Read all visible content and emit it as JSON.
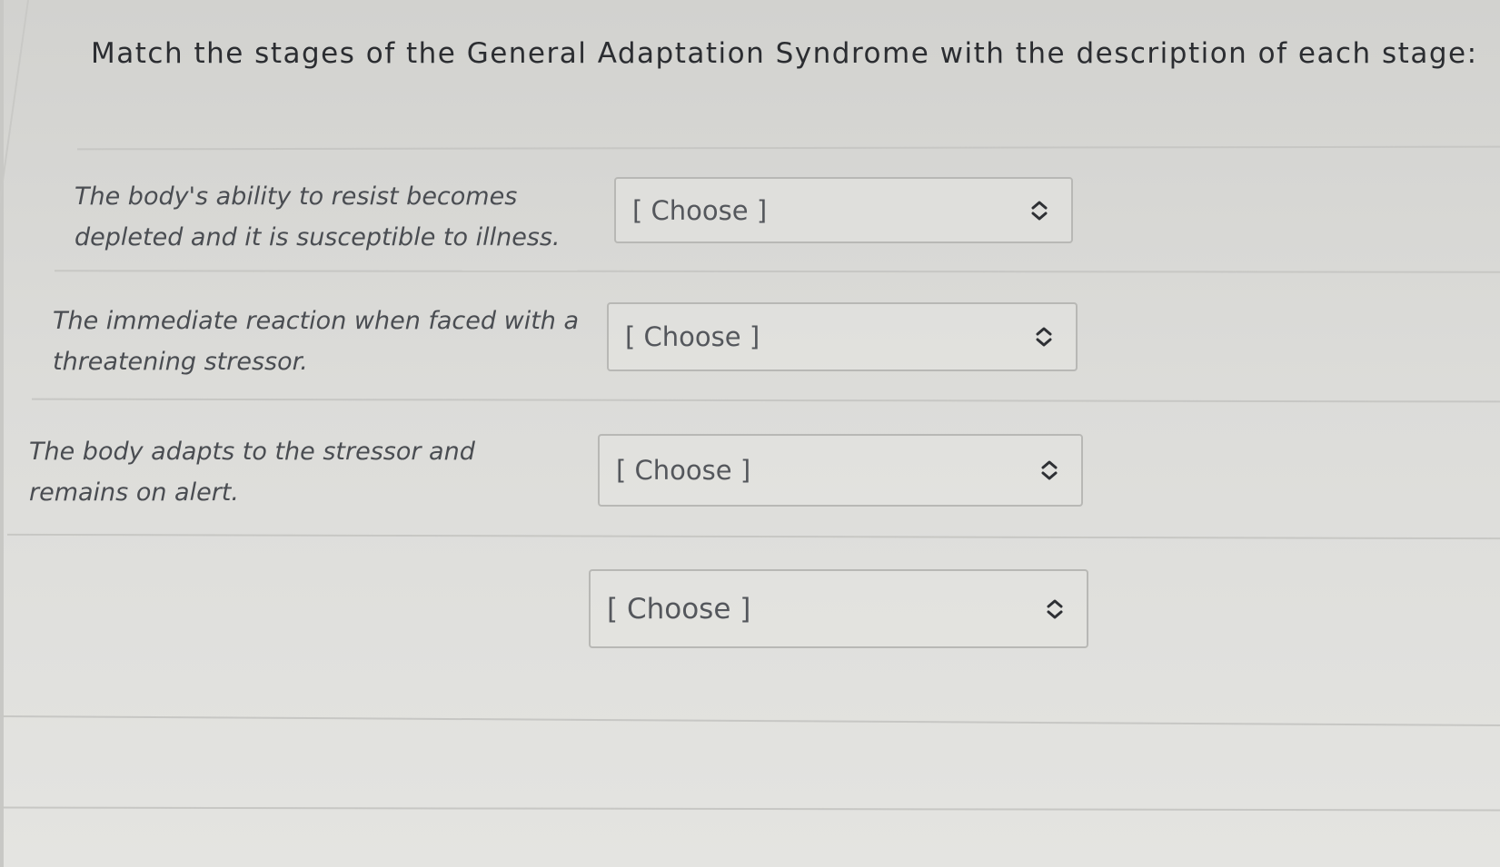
{
  "question": {
    "title": "Match the stages of the General Adaptation Syndrome with the description of each stage:"
  },
  "rows": [
    {
      "description": "The body's ability to resist becomes depleted and it is susceptible to illness.",
      "select_value": "[ Choose ]"
    },
    {
      "description": "The immediate reaction when faced with a threatening stressor.",
      "select_value": "[ Choose ]"
    },
    {
      "description": "The body adapts to the stressor and remains on alert.",
      "select_value": "[ Choose ]"
    },
    {
      "description": "",
      "select_value": "[ Choose ]"
    }
  ],
  "icons": {
    "select_arrow": "chevron-up-down-icon"
  }
}
